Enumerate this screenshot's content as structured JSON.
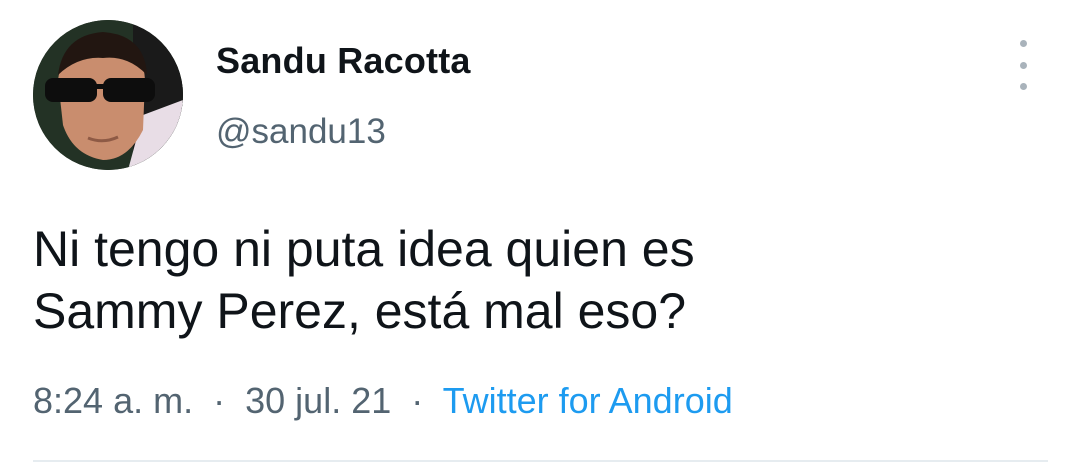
{
  "tweet": {
    "author": {
      "display_name": "Sandu Racotta",
      "handle": "@sandu13",
      "avatar_icon": "profile-photo"
    },
    "text": "Ni tengo ni puta idea quien es\nSammy Perez, está  mal eso?",
    "time": "8:24 a. m.",
    "separator": "·",
    "date": "30 jul. 21",
    "source": "Twitter for Android"
  },
  "icons": {
    "more": "more-options-icon"
  },
  "colors": {
    "text": "#0f1419",
    "secondary": "#536471",
    "link": "#1d9bf0",
    "divider": "#e6ecf0"
  }
}
